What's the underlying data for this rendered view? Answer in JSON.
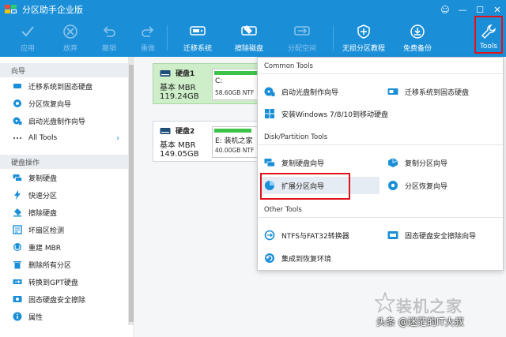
{
  "window": {
    "title": "分区助手企业版",
    "controls": [
      "☺",
      "—",
      "☐",
      "✕"
    ]
  },
  "toolbar": {
    "apply": "应用",
    "discard": "放弃",
    "undo": "撤销",
    "redo": "重做",
    "migrate": "迁移系统",
    "wipe": "擦除磁盘",
    "allocate": "分配空间",
    "tutorial": "无损分区教程",
    "backup": "免费备份",
    "tools": "Tools"
  },
  "sidebar": {
    "wizard_header": "向导",
    "wizard_items": [
      {
        "label": "迁移系统到固态硬盘",
        "icon": "migrate-icon"
      },
      {
        "label": "分区恢复向导",
        "icon": "recover-icon"
      },
      {
        "label": "启动光盘制作向导",
        "icon": "bootdisk-icon"
      },
      {
        "label": "All Tools",
        "icon": "dots-icon",
        "chevron": "›"
      }
    ],
    "disk_header": "硬盘操作",
    "disk_items": [
      {
        "label": "复制硬盘",
        "icon": "copy-disk-icon"
      },
      {
        "label": "快速分区",
        "icon": "lightning-icon"
      },
      {
        "label": "擦除硬盘",
        "icon": "eraser-icon"
      },
      {
        "label": "坏扇区检测",
        "icon": "checklist-icon"
      },
      {
        "label": "重建 MBR",
        "icon": "rebuild-icon"
      },
      {
        "label": "删除所有分区",
        "icon": "trash-icon"
      },
      {
        "label": "转换到GPT硬盘",
        "icon": "convert-icon"
      },
      {
        "label": "固态硬盘安全擦除",
        "icon": "ssd-erase-icon"
      },
      {
        "label": "属性",
        "icon": "info-icon"
      }
    ]
  },
  "disks": [
    {
      "name": "硬盘1",
      "type": "基本 MBR",
      "size": "119.24GB",
      "part_name": "C:",
      "part_info": "58.60GB NTF",
      "fill": 0.38
    },
    {
      "name": "硬盘2",
      "type": "基本 MBR",
      "size": "149.05GB",
      "part_name": "E: 装机之家",
      "part_info": "40.00GB NTF",
      "fill": 0.26
    }
  ],
  "tools_menu": {
    "common_header": "Common Tools",
    "common_items": [
      {
        "label": "启动光盘制作向导",
        "icon": "bootdisk-icon"
      },
      {
        "label": "迁移系统到固态硬盘",
        "icon": "migrate-icon"
      },
      {
        "label": "安装Windows 7/8/10到移动硬盘",
        "icon": "windows-icon"
      }
    ],
    "partition_header": "Disk/Partition Tools",
    "partition_items": [
      {
        "label": "复制硬盘向导",
        "icon": "copy-disk-icon"
      },
      {
        "label": "复制分区向导",
        "icon": "copy-partition-icon"
      },
      {
        "label": "扩展分区向导",
        "icon": "extend-partition-icon"
      },
      {
        "label": "分区恢复向导",
        "icon": "recover-icon"
      }
    ],
    "other_header": "Other Tools",
    "other_items": [
      {
        "label": "NTFS与FAT32转换器",
        "icon": "convert-fs-icon"
      },
      {
        "label": "固态硬盘安全擦除向导",
        "icon": "ssd-erase-icon"
      },
      {
        "label": "集成到恢复环境",
        "icon": "integrate-icon"
      }
    ]
  },
  "watermark": {
    "site": "装机之家",
    "credit": "头条 @迷茫的IT大叔"
  },
  "colors": {
    "titlebar": "#1a8fd8",
    "highlight_border": "#e0121a",
    "partition_used": "#3ec24a",
    "selected_disk": "#cdeec8"
  }
}
